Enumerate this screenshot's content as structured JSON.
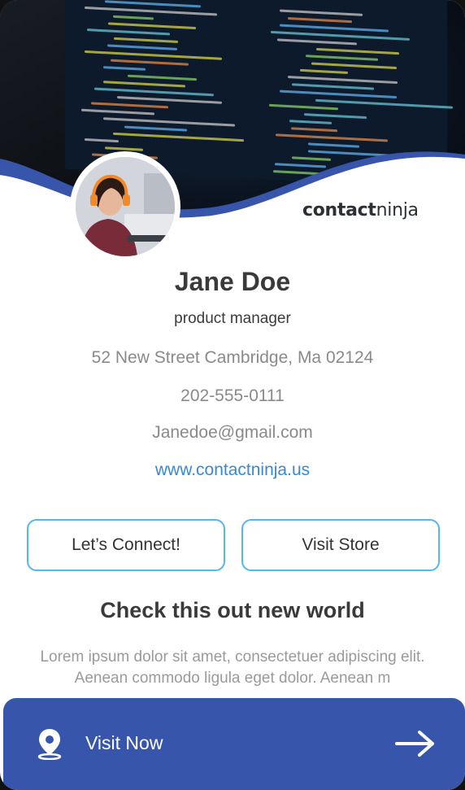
{
  "brand": {
    "part1": "contact",
    "part2": "ninja"
  },
  "profile": {
    "name": "Jane Doe",
    "title": "product manager",
    "address": "52 New Street Cambridge, Ma 02124",
    "phone": "202-555-0111",
    "email": "Janedoe@gmail.com",
    "website": "www.contactninja.us"
  },
  "buttons": {
    "connect_label": "Let’s Connect!",
    "store_label": "Visit Store"
  },
  "promo": {
    "heading": "Check this out new world",
    "body": "Lorem ipsum dolor sit amet, consectetuer adipiscing elit. Aenean commodo ligula eget dolor. Aenean m"
  },
  "visit_bar": {
    "label": "Visit Now"
  },
  "colors": {
    "accent_blue": "#3756ab",
    "button_border": "#57b6ea",
    "link": "#3a88d4"
  },
  "icons": {
    "location": "location-pin-icon",
    "arrow": "arrow-right-icon"
  }
}
